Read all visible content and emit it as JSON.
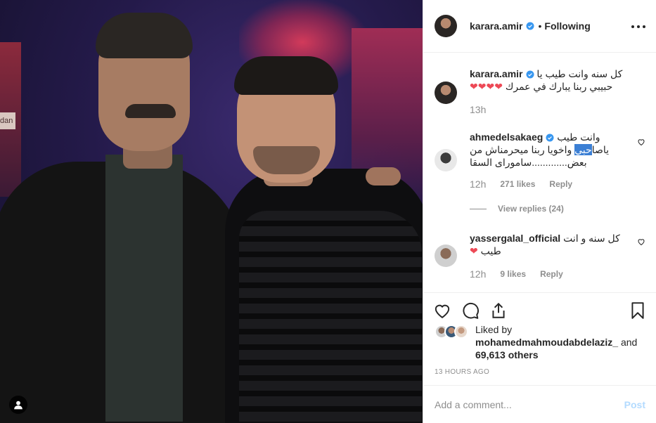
{
  "post": {
    "username": "karara.amir",
    "follow_status": "Following",
    "separator": "•"
  },
  "caption": {
    "username": "karara.amir",
    "text_line1": "كل سنه وانت طيب يا",
    "text_line2": "حبيبي ربنا يبارك في عمرك",
    "hearts": "❤❤❤❤",
    "time": "13h"
  },
  "comments": [
    {
      "username": "ahmedelsakaeg",
      "text_line1": "وانت طيب",
      "text_line2_pre": "ياصا",
      "text_line2_hl": "حبي",
      "text_line2_post": " واخويا ربنا ميحرمناش من",
      "text_line3": "بعض.............ساموراى السقا",
      "time": "12h",
      "likes": "271 likes",
      "reply": "Reply"
    },
    {
      "username": "yassergalal_official",
      "text_line1": "كل سنه و انت",
      "text_line2": "طيب",
      "heart": "❤",
      "time": "12h",
      "likes": "9 likes",
      "reply": "Reply"
    }
  ],
  "view_replies": "View replies (24)",
  "likes": {
    "prefix": "Liked by",
    "user": "mohamedmahmoudabdelaziz_",
    "and": "and",
    "others": "69,613 others"
  },
  "timestamp": "13 HOURS AGO",
  "add_comment": {
    "placeholder": "Add a comment...",
    "post_label": "Post"
  },
  "photo": {
    "sign_text": "dan"
  },
  "colors": {
    "verified": "#3897f0",
    "heart": "#ed4956",
    "selection": "#3b7fd4",
    "post_disabled": "#b3dbff",
    "muted": "#8e8e8e"
  },
  "icons": [
    "verified-badge-icon",
    "more-options-icon",
    "heart-icon",
    "comment-icon",
    "share-icon",
    "bookmark-icon",
    "user-tag-icon"
  ]
}
